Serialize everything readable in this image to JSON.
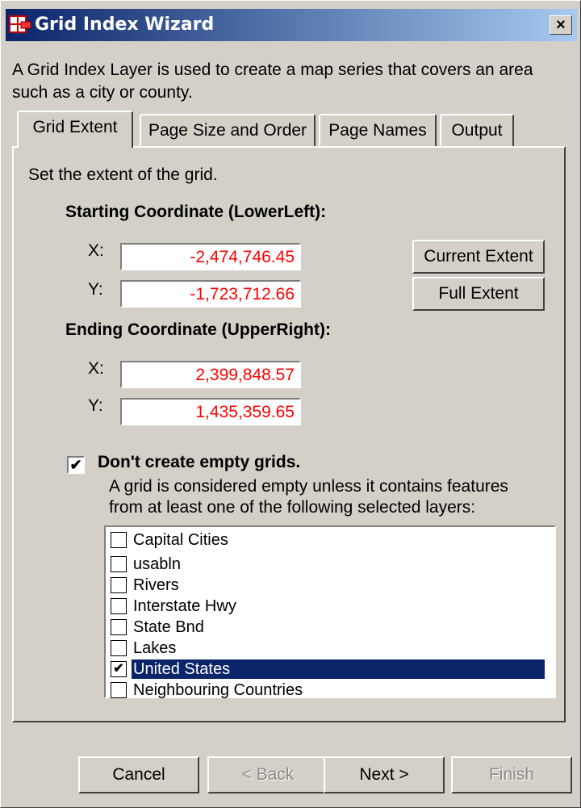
{
  "window": {
    "title": "Grid Index Wizard",
    "close_label": "×",
    "intro_text": "A Grid Index Layer is used to create a map series that covers an area such as a city or county."
  },
  "tabs": [
    {
      "label": "Grid Extent",
      "active": true
    },
    {
      "label": "Page Size and Order",
      "active": false
    },
    {
      "label": "Page Names",
      "active": false
    },
    {
      "label": "Output",
      "active": false
    }
  ],
  "panel": {
    "instruction": "Set the extent of the grid.",
    "starting": {
      "heading": "Starting Coordinate (LowerLeft):",
      "x_label": "X:",
      "x_value": "-2,474,746.45",
      "y_label": "Y:",
      "y_value": "-1,723,712.66"
    },
    "ending": {
      "heading": "Ending Coordinate (UpperRight):",
      "x_label": "X:",
      "x_value": "2,399,848.57",
      "y_label": "Y:",
      "y_value": "1,435,359.65"
    },
    "buttons": {
      "current_extent": "Current Extent",
      "full_extent": "Full Extent"
    },
    "empty_grids": {
      "checked": true,
      "label": "Don't create empty grids.",
      "description_line1": "A grid is considered empty unless it contains features",
      "description_line2": "from at least one of the following selected layers:"
    },
    "layers": [
      {
        "name": "Capital Cities",
        "checked": false,
        "selected": false
      },
      {
        "name": "usabln",
        "checked": false,
        "selected": false
      },
      {
        "name": "Rivers",
        "checked": false,
        "selected": false
      },
      {
        "name": "Interstate Hwy",
        "checked": false,
        "selected": false
      },
      {
        "name": "State Bnd",
        "checked": false,
        "selected": false
      },
      {
        "name": "Lakes",
        "checked": false,
        "selected": false
      },
      {
        "name": "United States",
        "checked": true,
        "selected": true
      },
      {
        "name": "Neighbouring Countries",
        "checked": false,
        "selected": false
      }
    ]
  },
  "footer": {
    "cancel": "Cancel",
    "back": "< Back",
    "next": "Next >",
    "finish": "Finish"
  },
  "colors": {
    "titlebar_start": "#0a246a",
    "titlebar_end": "#a6caf0",
    "coordinate_text": "#ff0000",
    "selection": "#0a246a"
  }
}
